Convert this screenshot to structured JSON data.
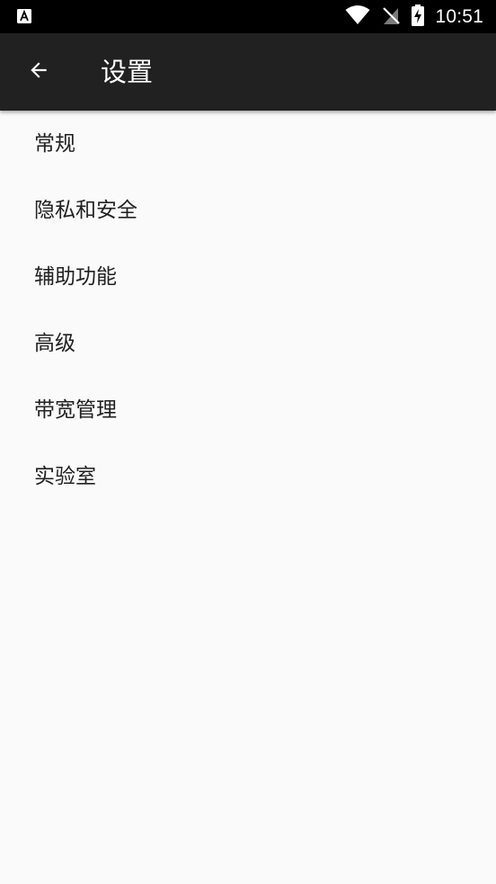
{
  "status_bar": {
    "time": "10:51",
    "icons": [
      "notification-a-icon",
      "wifi-icon",
      "no-sim-icon",
      "battery-charging-icon"
    ]
  },
  "app_bar": {
    "back_icon": "arrow-back-icon",
    "title": "设置"
  },
  "settings": {
    "items": [
      {
        "label": "常规"
      },
      {
        "label": "隐私和安全"
      },
      {
        "label": "辅助功能"
      },
      {
        "label": "高级"
      },
      {
        "label": "带宽管理"
      },
      {
        "label": "实验室"
      }
    ]
  },
  "colors": {
    "status_bar_bg": "#000000",
    "app_bar_bg": "#212121",
    "page_bg": "#fafafa",
    "item_text": "#212121"
  }
}
